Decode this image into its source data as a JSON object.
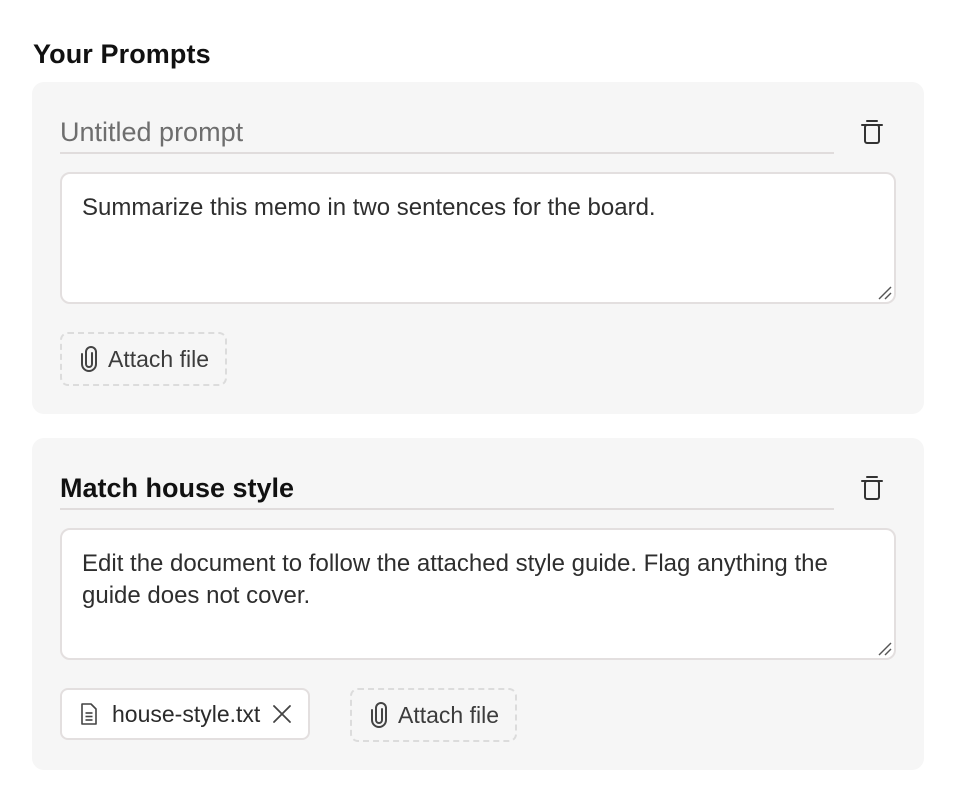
{
  "section": {
    "title": "Your Prompts"
  },
  "prompts": [
    {
      "title_value": "",
      "title_placeholder": "Untitled prompt",
      "body": "Summarize this memo in two sentences for the board.",
      "attachments": [],
      "attach_label": "Attach file"
    },
    {
      "title_value": "Match house style",
      "title_placeholder": "Untitled prompt",
      "body": "Edit the document to follow the attached style guide. Flag anything the guide does not cover.",
      "attachments": [
        {
          "file_name": "house-style.txt"
        }
      ],
      "attach_label": "Attach file"
    }
  ],
  "icons": {
    "delete": "trash-icon",
    "attach": "paperclip-icon",
    "file": "document-icon",
    "remove": "close-icon"
  },
  "colors": {
    "card_background": "#f6f6f6",
    "input_border": "#e3dfdf",
    "dashed_border": "#dcdcdc"
  }
}
